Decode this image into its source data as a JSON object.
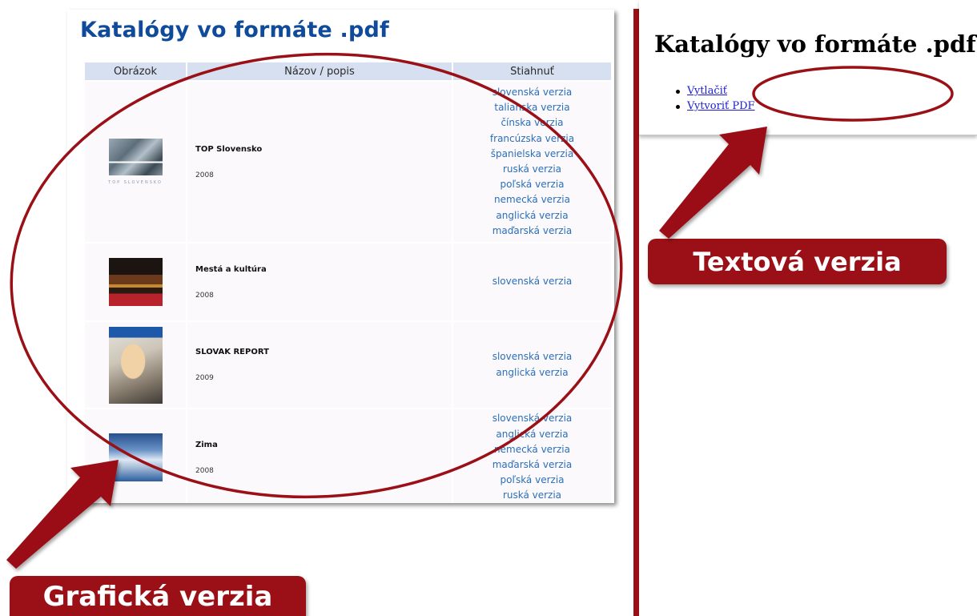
{
  "graphical_version": {
    "title": "Katalógy vo formáte .pdf",
    "columns": [
      "Obrázok",
      "Názov / popis",
      "Stiahnuť"
    ],
    "catalogs": [
      {
        "name": "TOP Slovensko",
        "year": "2008",
        "thumb_caption": "TOP SLOVENSKO",
        "downloads": [
          "slovenská verzia",
          "talianska verzia",
          "čínska verzia",
          "francúzska verzia",
          "španielska verzia",
          "ruská verzia",
          "poľská verzia",
          "nemecká verzia",
          "anglická verzia",
          "maďarská verzia"
        ]
      },
      {
        "name": "Mestá a kultúra",
        "year": "2008",
        "downloads": [
          "slovenská verzia"
        ]
      },
      {
        "name": "SLOVAK REPORT",
        "year": "2009",
        "downloads": [
          "slovenská verzia",
          "anglická verzia"
        ]
      },
      {
        "name": "Zima",
        "year": "2008",
        "downloads": [
          "slovenská verzia",
          "anglická verzia",
          "nemecká verzia",
          "maďarská verzia",
          "poľská verzia",
          "ruská verzia"
        ]
      }
    ]
  },
  "text_version": {
    "title": "Katalógy vo formáte .pdf",
    "links": [
      "Vytlačiť",
      "Vytvoriť PDF"
    ]
  },
  "labels": {
    "text_version": "Textová verzia",
    "graphical_version": "Grafická verzia"
  },
  "colors": {
    "accent": "#9a1016",
    "title_blue": "#0f4b9a",
    "link_blue": "#2a6fb8",
    "header_bg": "#d7e0f0"
  },
  "icons": {
    "arrow": "arrow-icon",
    "ellipse": "highlight-ellipse"
  }
}
